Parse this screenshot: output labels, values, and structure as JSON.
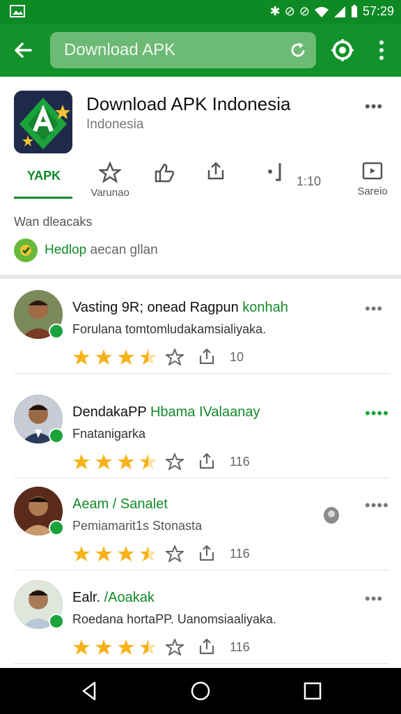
{
  "status": {
    "time": "57:29"
  },
  "search": {
    "query": "Download APK"
  },
  "app": {
    "title": "Download APK Indonesia",
    "subtitle": "Indonesia",
    "tabs": [
      {
        "label": "YAPK"
      },
      {
        "label": "Varunao"
      },
      {
        "label": ""
      },
      {
        "label": ""
      },
      {
        "label": "Sareio"
      }
    ],
    "count": "1:10",
    "section_text": "Wan dleacaks",
    "help_text_green": "Hedlop",
    "help_text_gray": " aecan gllan"
  },
  "reviews": [
    {
      "name": "Vasting 9R; onead Ragpun",
      "name_green": " konhah",
      "text": "Forulana tomtomludakamsialiyaka.",
      "stars": 3.5,
      "count": "10"
    },
    {
      "name": "DendakaPP",
      "name_green": " Hbama IValaanay",
      "text": "Fnatanigarka",
      "stars": 3.5,
      "count": "116"
    },
    {
      "name": "",
      "name_green": "Aeam / Sanalet",
      "text": "Pemiamarit1s Stonasta",
      "stars": 3.5,
      "count": "116"
    },
    {
      "name": "Ealr.",
      "name_green": " /Aoakak",
      "text": "Roedana hortaPP. Uanomsiaaliyaka.",
      "stars": 3.5,
      "count": "116"
    }
  ],
  "colors": {
    "primary": "#12922a",
    "status": "#0d8a24",
    "accent": "#118a2a",
    "star": "#f7b21a"
  },
  "icons": [
    "back-arrow-icon",
    "reload-icon",
    "target-icon",
    "more-vertical-icon",
    "more-horizontal-icon",
    "star-icon",
    "share-icon",
    "thumb-icon",
    "screen-icon"
  ]
}
